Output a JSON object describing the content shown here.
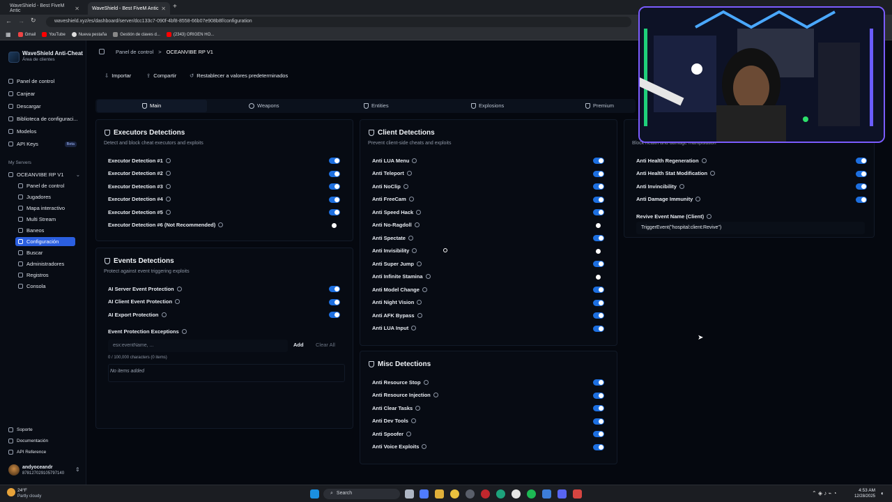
{
  "browser": {
    "tabs": [
      {
        "title": "WaveShield - Best FiveM Antic"
      },
      {
        "title": "WaveShield - Best FiveM Antic"
      }
    ],
    "url": "waveshield.xyz/es/dashboard/server/dcc133c7-090f-4bf8-8558-66b07e908b8f/configuration",
    "bookmarks": [
      "Gmail",
      "YouTube",
      "Nueva pestaña",
      "Gestión de claves d...",
      "(2343) ORIGEN HO..."
    ]
  },
  "sidebar": {
    "app_name": "WaveShield Anti-Cheat",
    "app_sub": "Área de clientes",
    "nav": [
      {
        "label": "Panel de control"
      },
      {
        "label": "Canjear"
      },
      {
        "label": "Descargar"
      },
      {
        "label": "Biblioteca de configuraci..."
      },
      {
        "label": "Modelos"
      },
      {
        "label": "API Keys",
        "badge": "Beta"
      }
    ],
    "servers_heading": "My Servers",
    "server_name": "OCEANVIBE RP V1",
    "server_items": [
      {
        "label": "Panel de control"
      },
      {
        "label": "Jugadores"
      },
      {
        "label": "Mapa interactivo"
      },
      {
        "label": "Multi Stream"
      },
      {
        "label": "Baneos"
      },
      {
        "label": "Configuración",
        "active": true
      },
      {
        "label": "Buscar"
      },
      {
        "label": "Administradores"
      },
      {
        "label": "Registros"
      },
      {
        "label": "Consola"
      }
    ],
    "footer": [
      {
        "label": "Soporte"
      },
      {
        "label": "Documentación"
      },
      {
        "label": "API Reference"
      }
    ],
    "user": {
      "name": "andyoceandr",
      "id": "878127029105797140"
    }
  },
  "header": {
    "breadcrumb_root": "Panel de control",
    "breadcrumb_sep": ">",
    "breadcrumb_current": "OCEANVIBE RP V1"
  },
  "toolbar": {
    "import": "Importar",
    "share": "Compartir",
    "reset": "Restablecer a valores predeterminados"
  },
  "tabs": [
    "Main",
    "Weapons",
    "Entities",
    "Explosions",
    "Premium"
  ],
  "executors": {
    "title": "Executors Detections",
    "subtitle": "Detect and block cheat executors and exploits",
    "rows": [
      {
        "label": "Executor Detection #1",
        "on": true
      },
      {
        "label": "Executor Detection #2",
        "on": true
      },
      {
        "label": "Executor Detection #3",
        "on": true
      },
      {
        "label": "Executor Detection #4",
        "on": true
      },
      {
        "label": "Executor Detection #5",
        "on": true
      },
      {
        "label": "Executor Detection #6 (Not Recommended)",
        "on": false
      }
    ]
  },
  "events": {
    "title": "Events Detections",
    "subtitle": "Protect against event triggering exploits",
    "rows": [
      {
        "label": "AI Server Event Protection",
        "on": true
      },
      {
        "label": "AI Client Event Protection",
        "on": true
      },
      {
        "label": "AI Export Protection",
        "on": true
      }
    ],
    "exceptions_label": "Event Protection Exceptions",
    "input_placeholder": "esx:eventName, ...",
    "add": "Add",
    "clear": "Clear All",
    "counter": "0 / 100,000 characters (0 items)",
    "empty": "No items added"
  },
  "client": {
    "title": "Client Detections",
    "subtitle": "Prevent client-side cheats and exploits",
    "rows": [
      {
        "label": "Anti LUA Menu",
        "on": true
      },
      {
        "label": "Anti Teleport",
        "on": true
      },
      {
        "label": "Anti NoClip",
        "on": true
      },
      {
        "label": "Anti FreeCam",
        "on": true
      },
      {
        "label": "Anti Speed Hack",
        "on": true
      },
      {
        "label": "Anti No-Ragdoll",
        "on": false
      },
      {
        "label": "Anti Spectate",
        "on": true
      },
      {
        "label": "Anti Invisibility",
        "on": false
      },
      {
        "label": "Anti Super Jump",
        "on": true
      },
      {
        "label": "Anti Infinite Stamina",
        "on": false
      },
      {
        "label": "Anti Model Change",
        "on": true
      },
      {
        "label": "Anti Night Vision",
        "on": true
      },
      {
        "label": "Anti AFK Bypass",
        "on": true
      },
      {
        "label": "Anti LUA Input",
        "on": true
      }
    ]
  },
  "misc": {
    "title": "Misc Detections",
    "rows": [
      {
        "label": "Anti Resource Stop",
        "on": true
      },
      {
        "label": "Anti Resource Injection",
        "on": true
      },
      {
        "label": "Anti Clear Tasks",
        "on": true
      },
      {
        "label": "Anti Dev Tools",
        "on": true
      },
      {
        "label": "Anti Spoofer",
        "on": true
      },
      {
        "label": "Anti Voice Exploits",
        "on": true
      }
    ]
  },
  "health": {
    "subtitle": "Block health and damage manipulation",
    "rows": [
      {
        "label": "Anti Health Regeneration",
        "on": true
      },
      {
        "label": "Anti Health Stat Modification",
        "on": true
      },
      {
        "label": "Anti Invincibility",
        "on": true
      },
      {
        "label": "Anti Damage Immunity",
        "on": true
      }
    ],
    "revive_label": "Revive Event Name (Client)",
    "revive_value": "TriggerEvent(\"hospital:client:Revive\")"
  },
  "taskbar": {
    "weather_temp": "24°F",
    "weather_desc": "Partly cloudy",
    "search": "Search",
    "time": "4:53 AM",
    "date": "12/28/2025"
  }
}
